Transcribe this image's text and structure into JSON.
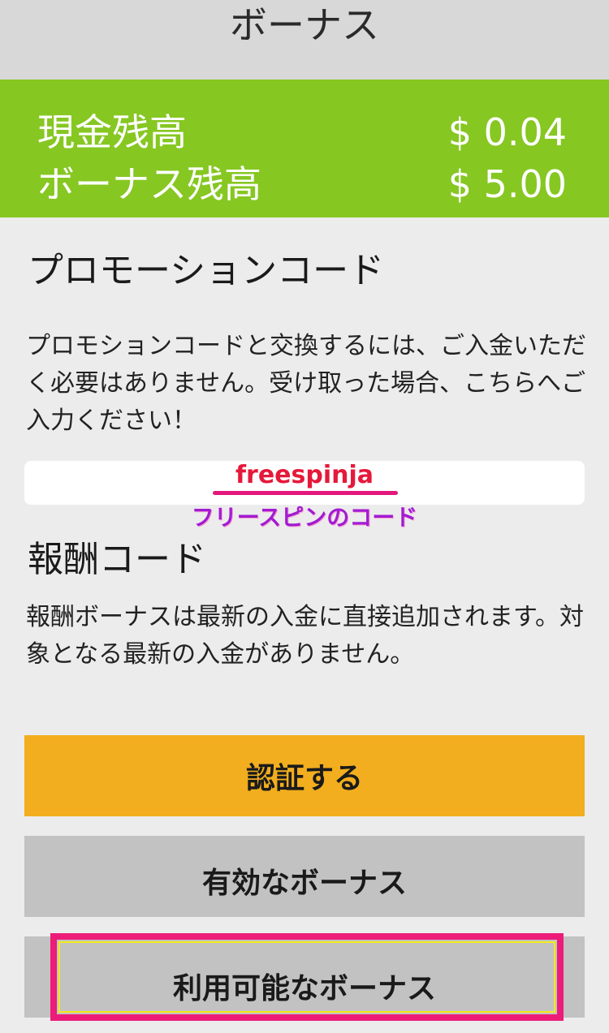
{
  "header": {
    "title": "ボーナス"
  },
  "balance": {
    "cash_label": "現金残高",
    "cash_value": "$ 0.04",
    "bonus_label": "ボーナス残高",
    "bonus_value": "$ 5.00"
  },
  "promo": {
    "title": "プロモーションコード",
    "description": "プロモションコードと交換するには、ご入金いただく必要はありません。受け取った場合、こちらへご入力ください！",
    "code_value": "freespinja",
    "code_caption": "フリースピンのコード"
  },
  "reward": {
    "title": "報酬コード",
    "description": "報酬ボーナスは最新の入金に直接追加されます。対象となる最新の入金がありません。"
  },
  "buttons": {
    "verify": "認証する",
    "active_bonus": "有効なボーナス",
    "available_bonus": "利用可能なボーナス"
  },
  "colors": {
    "balance_bg": "#86c722",
    "verify_bg": "#f2ae1e",
    "highlight": "#ec1c79"
  }
}
